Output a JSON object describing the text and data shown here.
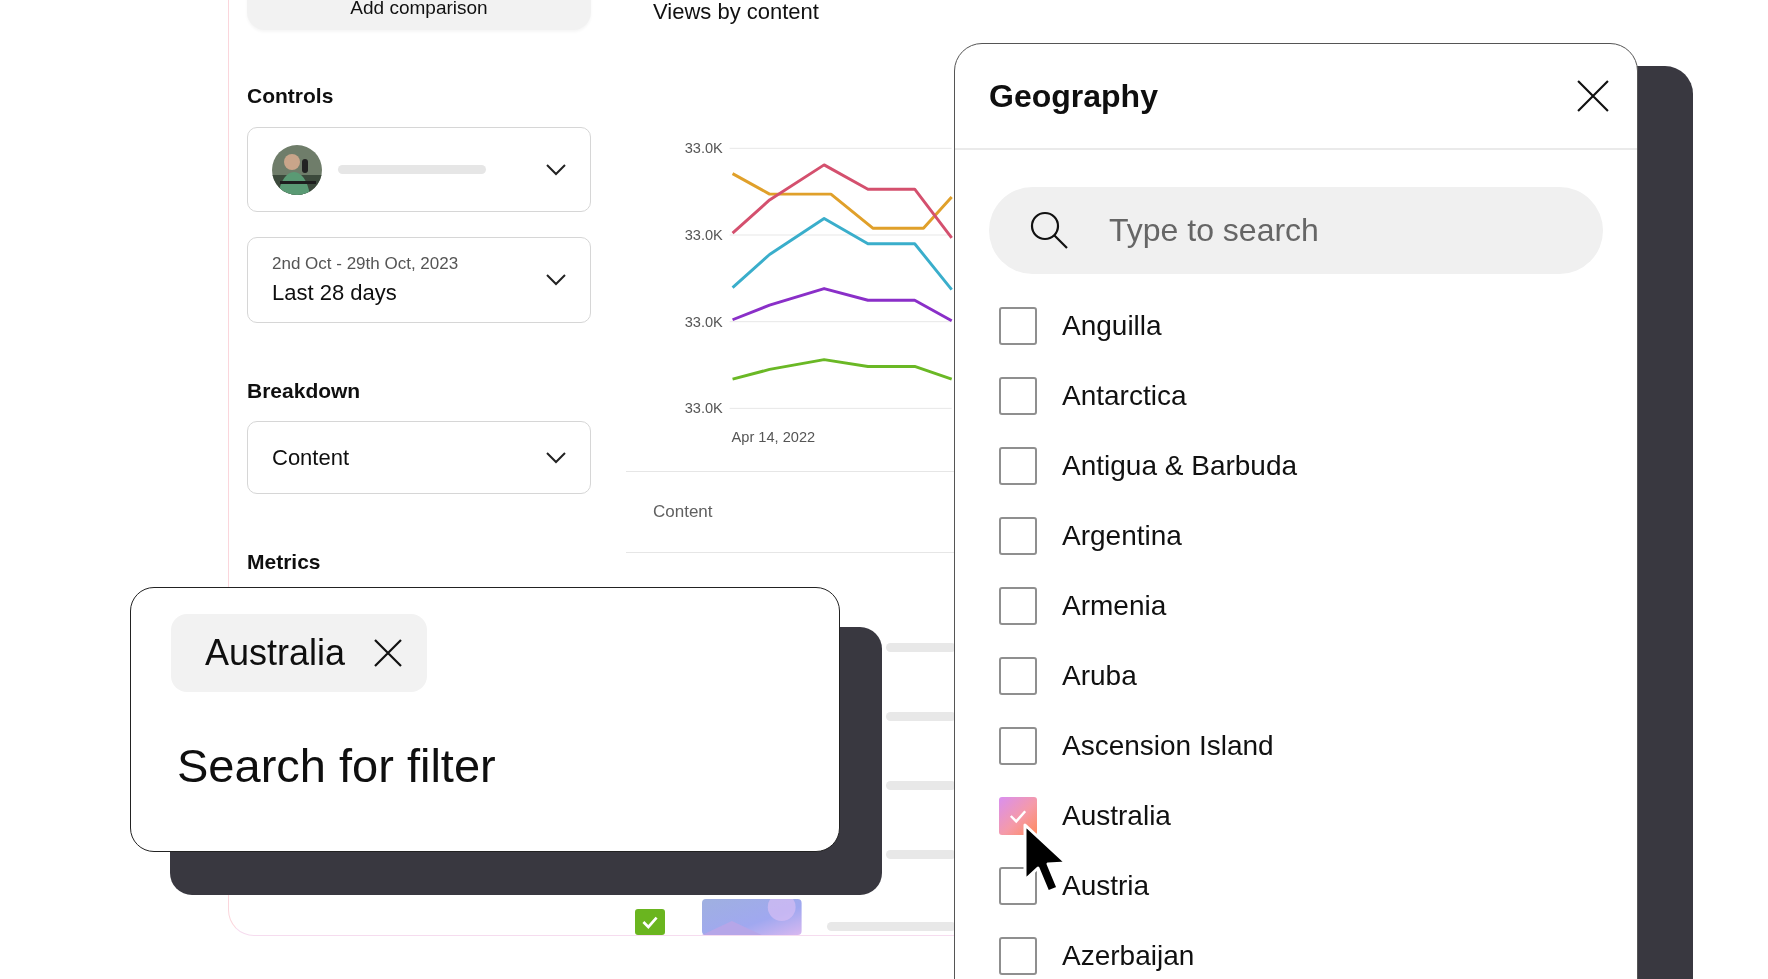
{
  "add_comparison_button": "Add comparison",
  "controls": {
    "heading": "Controls",
    "date_select": {
      "range": "2nd Oct - 29th Oct, 2023",
      "value": "Last 28 days"
    }
  },
  "breakdown": {
    "heading": "Breakdown",
    "value": "Content"
  },
  "metrics_heading": "Metrics",
  "chart": {
    "title": "Views by content",
    "y_tick_labels": [
      "33.0K",
      "33.0K",
      "33.0K",
      "33.0K"
    ],
    "x_label": "Apr 14, 2022"
  },
  "table": {
    "column_header": "Content",
    "rows": [
      {
        "checked": true
      }
    ]
  },
  "filter": {
    "chip": "Australia",
    "text": "Search for filter"
  },
  "geography": {
    "title": "Geography",
    "search": {
      "placeholder": "Type to search"
    },
    "countries": [
      {
        "name": "Anguilla",
        "checked": false
      },
      {
        "name": "Antarctica",
        "checked": false
      },
      {
        "name": "Antigua & Barbuda",
        "checked": false
      },
      {
        "name": "Argentina",
        "checked": false
      },
      {
        "name": "Armenia",
        "checked": false
      },
      {
        "name": "Aruba",
        "checked": false
      },
      {
        "name": "Ascension Island",
        "checked": false
      },
      {
        "name": "Australia",
        "checked": true
      },
      {
        "name": "Austria",
        "checked": false
      },
      {
        "name": "Azerbaijan",
        "checked": false
      }
    ]
  }
}
